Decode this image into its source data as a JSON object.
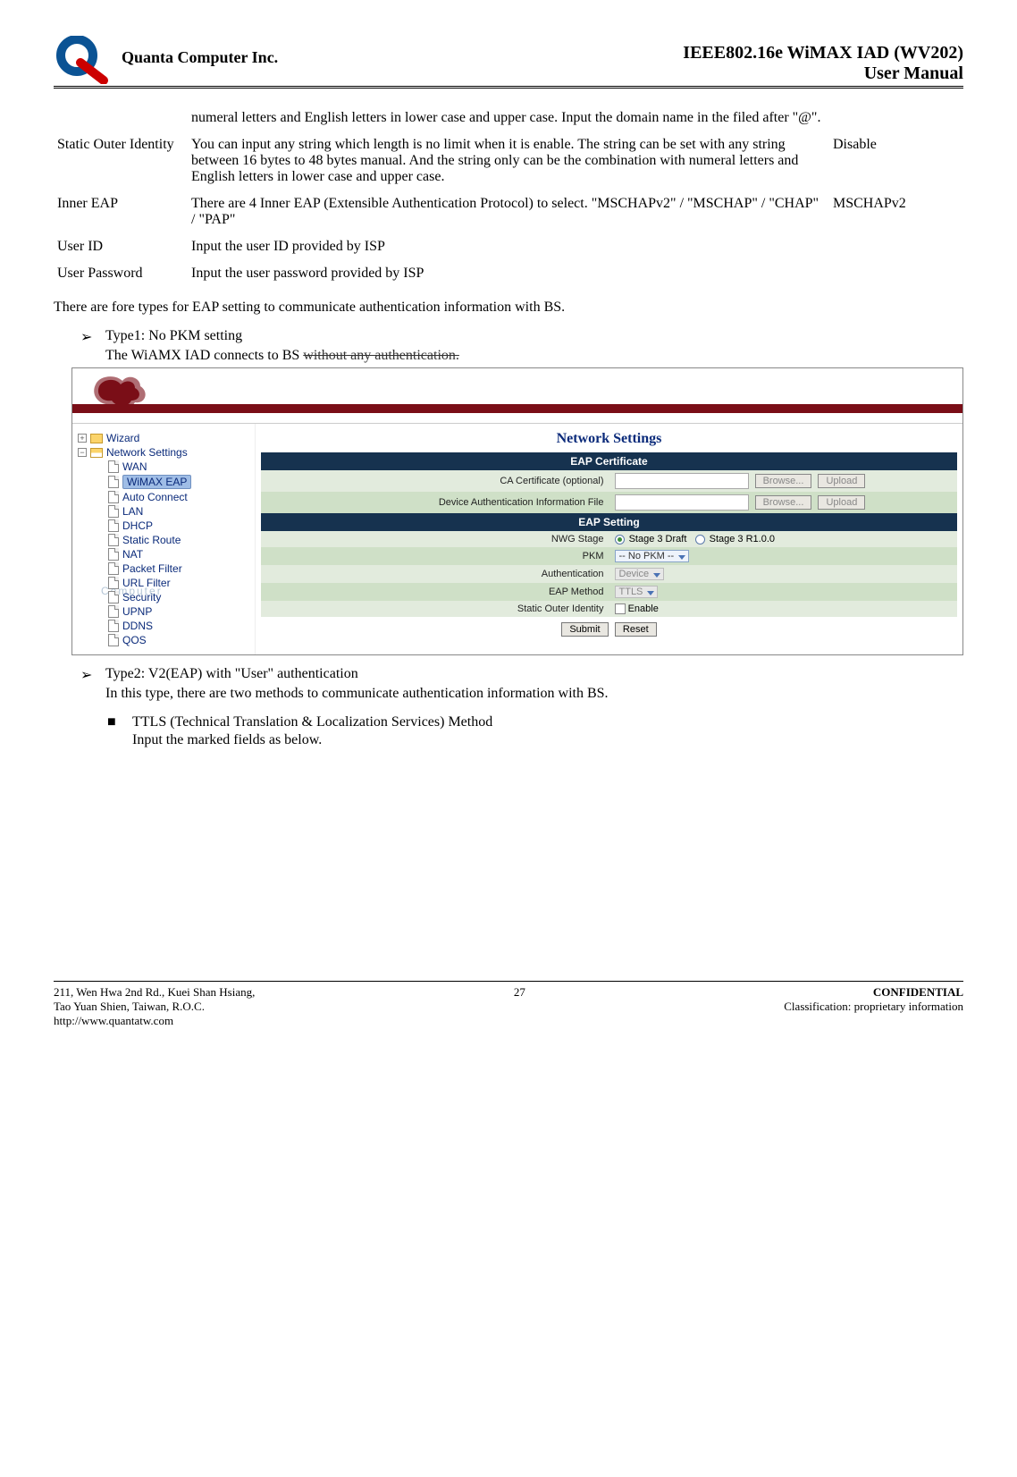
{
  "header": {
    "company": "Quanta  Computer  Inc.",
    "title1": "IEEE802.16e  WiMAX  IAD  (WV202)",
    "title2": "User  Manual"
  },
  "params": {
    "row0": {
      "desc": "numeral letters and English letters in lower case and upper case. Input the domain name in the filed after \"@\"."
    },
    "row1": {
      "name": "Static Outer Identity",
      "desc": "You can input any string which length is no limit when it is enable. The string can be set with any string between 16 bytes to 48 bytes manual. And the string only can be the combination with numeral letters and English letters in lower case and upper case.",
      "def": "Disable"
    },
    "row2": {
      "name": "Inner EAP",
      "desc": "There are 4 Inner EAP (Extensible Authentication Protocol) to select. \"MSCHAPv2\" / \"MSCHAP\" / \"CHAP\" / \"PAP\"",
      "def": "MSCHAPv2"
    },
    "row3": {
      "name": "User ID",
      "desc": "Input the user ID provided by ISP"
    },
    "row4": {
      "name": "User Password",
      "desc": "Input the user password provided by ISP"
    }
  },
  "para1": "There are fore types for EAP setting to communicate authentication information with BS.",
  "type1": {
    "title": "Type1: No PKM setting",
    "line1a": "The WiAMX IAD connects to BS ",
    "line1b": "without any authentication."
  },
  "type2": {
    "title": "Type2: V2(EAP) with \"User\" authentication",
    "sub": "In this type, there are two methods to communicate authentication information with BS.",
    "m1": "TTLS (Technical Translation & Localization Services) Method",
    "m1sub": "Input the marked fields as below."
  },
  "ss": {
    "tree": {
      "wizard": "Wizard",
      "network": "Network Settings",
      "wan": "WAN",
      "wimax": "WiMAX EAP",
      "auto": "Auto Connect",
      "lan": "LAN",
      "dhcp": "DHCP",
      "sroute": "Static Route",
      "nat": "NAT",
      "pfilter": "Packet Filter",
      "urlf": "URL Filter",
      "sec": "Security",
      "upnp": "UPNP",
      "ddns": "DDNS",
      "qos": "QOS",
      "computer": "Computer"
    },
    "title": "Network Settings",
    "s1": "EAP Certificate",
    "s2": "EAP Setting",
    "labels": {
      "ca": "CA Certificate (optional)",
      "dev": "Device Authentication Information File",
      "nwg": "NWG Stage",
      "pkm": "PKM",
      "auth": "Authentication",
      "eapm": "EAP Method",
      "soi": "Static Outer Identity"
    },
    "vals": {
      "browse": "Browse...",
      "upload": "Upload",
      "stage_a": "Stage 3 Draft",
      "stage_b": "Stage 3 R1.0.0",
      "pkm_sel": "-- No PKM --",
      "auth_sel": "Device",
      "eapm_sel": "TTLS",
      "enable": "Enable",
      "submit": "Submit",
      "reset": "Reset"
    }
  },
  "footer": {
    "addr1": "211, Wen Hwa 2nd Rd., Kuei Shan Hsiang,",
    "addr2": "Tao Yuan Shien, Taiwan, R.O.C.",
    "addr3": "http://www.quantatw.com",
    "page": "27",
    "conf": "CONFIDENTIAL",
    "class": "Classification: proprietary information"
  }
}
